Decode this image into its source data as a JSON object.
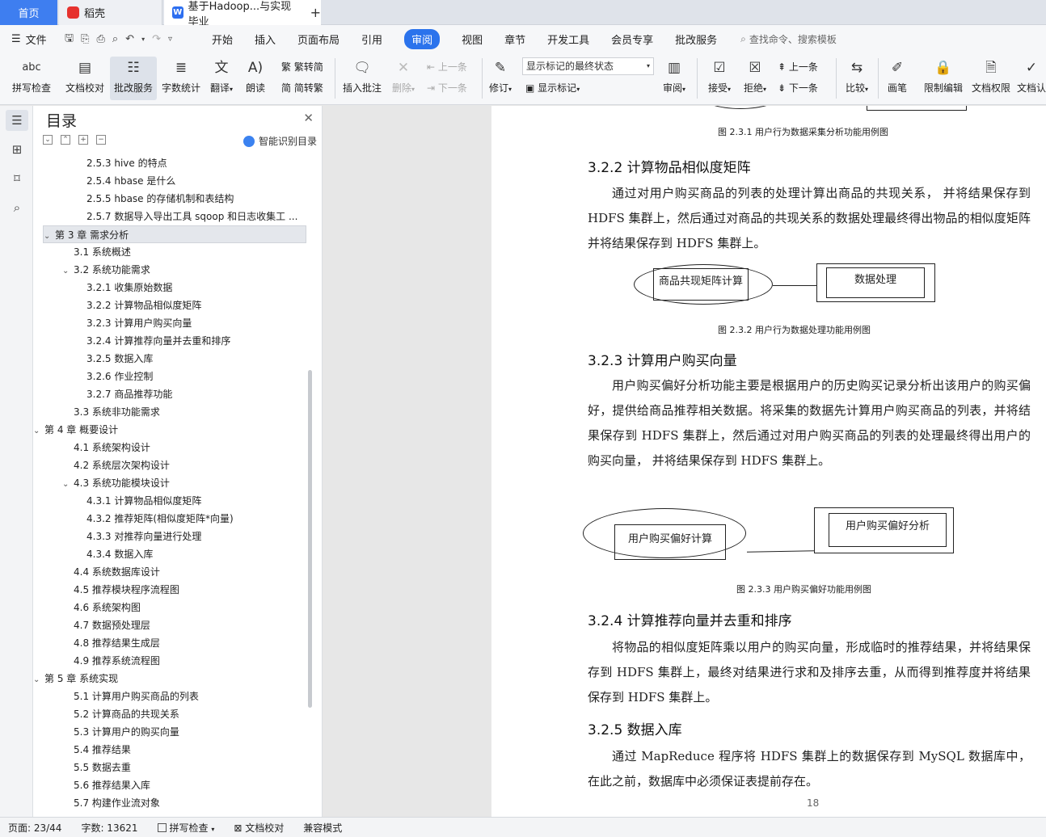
{
  "tabs": {
    "home": "首页",
    "daoke": "稻壳",
    "doc": "基于Hadoop...与实现 毕业"
  },
  "menu": {
    "file": "文件",
    "items": [
      "开始",
      "插入",
      "页面布局",
      "引用",
      "审阅",
      "视图",
      "章节",
      "开发工具",
      "会员专享",
      "批改服务"
    ],
    "active": "审阅",
    "search": "查找命令、搜索模板"
  },
  "ribbon": {
    "spellcheck": "拼写检查",
    "doccheck": "文档校对",
    "correction": "批改服务",
    "wordcount": "字数统计",
    "translate": "翻译",
    "read": "朗读",
    "trad": "繁转简",
    "simp": "简转繁",
    "insert_comment": "插入批注",
    "delete": "删除",
    "prev_comment": "上一条",
    "next_comment": "下一条",
    "revise": "修订",
    "show_select": "显示标记的最终状态",
    "show_mark": "显示标记",
    "review": "审阅",
    "accept": "接受",
    "reject": "拒绝",
    "prev": "上一条",
    "next": "下一条",
    "compare": "比较",
    "pen": "画笔",
    "restrict": "限制编辑",
    "perm": "文档权限",
    "doc_cert": "文档认"
  },
  "toc": {
    "title": "目录",
    "smart": "智能识别目录",
    "items": [
      {
        "text": "2.5.3 hive 的特点",
        "level": 3
      },
      {
        "text": "2.5.4 hbase 是什么",
        "level": 3
      },
      {
        "text": "2.5.5 hbase 的存储机制和表结构",
        "level": 3
      },
      {
        "text": "2.5.7  数据导入导出工具 sqoop 和日志收集工 ...",
        "level": 3
      },
      {
        "text": "第 3 章  需求分析",
        "level": 1,
        "caret": true,
        "hl": true
      },
      {
        "text": "3.1  系统概述",
        "level": 2
      },
      {
        "text": "3.2  系统功能需求",
        "level": 2,
        "caret": true
      },
      {
        "text": "3.2.1  收集原始数据",
        "level": 3
      },
      {
        "text": "3.2.2  计算物品相似度矩阵",
        "level": 3
      },
      {
        "text": "3.2.3  计算用户购买向量",
        "level": 3
      },
      {
        "text": "3.2.4  计算推荐向量并去重和排序",
        "level": 3
      },
      {
        "text": "3.2.5  数据入库",
        "level": 3
      },
      {
        "text": "3.2.6  作业控制",
        "level": 3
      },
      {
        "text": "3.2.7 商品推荐功能",
        "level": 3
      },
      {
        "text": "3.3  系统非功能需求",
        "level": 2
      },
      {
        "text": "第 4 章  概要设计",
        "level": 1,
        "caret": true
      },
      {
        "text": "4.1 系统架构设计",
        "level": 2
      },
      {
        "text": "4.2 系统层次架构设计",
        "level": 2
      },
      {
        "text": "4.3 系统功能模块设计",
        "level": 2,
        "caret": true
      },
      {
        "text": "4.3.1  计算物品相似度矩阵",
        "level": 3
      },
      {
        "text": "4.3.2 推荐矩阵(相似度矩阵*向量)",
        "level": 3
      },
      {
        "text": "4.3.3 对推荐向量进行处理",
        "level": 3
      },
      {
        "text": "4.3.4 数据入库",
        "level": 3
      },
      {
        "text": "4.4 系统数据库设计",
        "level": 2
      },
      {
        "text": "4.5 推荐模块程序流程图",
        "level": 2
      },
      {
        "text": "4.6 系统架构图",
        "level": 2
      },
      {
        "text": "4.7 数据预处理层",
        "level": 2
      },
      {
        "text": "4.8 推荐结果生成层",
        "level": 2
      },
      {
        "text": "4.9 推荐系统流程图",
        "level": 2
      },
      {
        "text": "第 5 章  系统实现",
        "level": 1,
        "caret": true
      },
      {
        "text": "5.1 计算用户购买商品的列表",
        "level": 2
      },
      {
        "text": "5.2 计算商品的共现关系",
        "level": 2
      },
      {
        "text": "5.3 计算用户的购买向量",
        "level": 2
      },
      {
        "text": "5.4 推荐结果",
        "level": 2
      },
      {
        "text": "5.5 数据去重",
        "level": 2
      },
      {
        "text": "5.6 推荐结果入库",
        "level": 2
      },
      {
        "text": "5.7 构建作业流对象",
        "level": 2
      }
    ]
  },
  "doc": {
    "cap1": "图 2.3.1  用户行为数据采集分析功能用例图",
    "h322": "3.2.2  计算物品相似度矩阵",
    "p322": "通过对用户购买商品的列表的处理计算出商品的共现关系， 并将结果保存到 HDFS 集群上，然后通过对商品的共现关系的数据处理最终得出物品的相似度矩阵并将结果保存到 HDFS 集群上。",
    "d2_left": "商品共现矩阵计算",
    "d2_right": "数据处理",
    "cap2": "图 2.3.2  用户行为数据处理功能用例图",
    "h323": "3.2.3  计算用户购买向量",
    "p323": "用户购买偏好分析功能主要是根据用户的历史购买记录分析出该用户的购买偏好，提供给商品推荐相关数据。将采集的数据先计算用户购买商品的列表，并将结果保存到 HDFS 集群上，然后通过对用户购买商品的列表的处理最终得出用户的购买向量，  并将结果保存到 HDFS 集群上。",
    "d3_left": "用户购买偏好计算",
    "d3_right": "用户购买偏好分析",
    "cap3": "图 2.3.3  用户购买偏好功能用例图",
    "h324": "3.2.4  计算推荐向量并去重和排序",
    "p324": "将物品的相似度矩阵乘以用户的购买向量，形成临时的推荐结果，并将结果保存到 HDFS 集群上，最终对结果进行求和及排序去重，从而得到推荐度并将结果保存到 HDFS 集群上。",
    "h325": "3.2.5  数据入库",
    "p325": "通过 MapReduce 程序将 HDFS 集群上的数据保存到 MySQL 数据库中，在此之前，数据库中必须保证表提前存在。",
    "page_number": "18"
  },
  "status": {
    "page": "页面: 23/44",
    "words": "字数: 13621",
    "spell": "拼写检查",
    "proof": "文档校对",
    "compat": "兼容模式"
  }
}
